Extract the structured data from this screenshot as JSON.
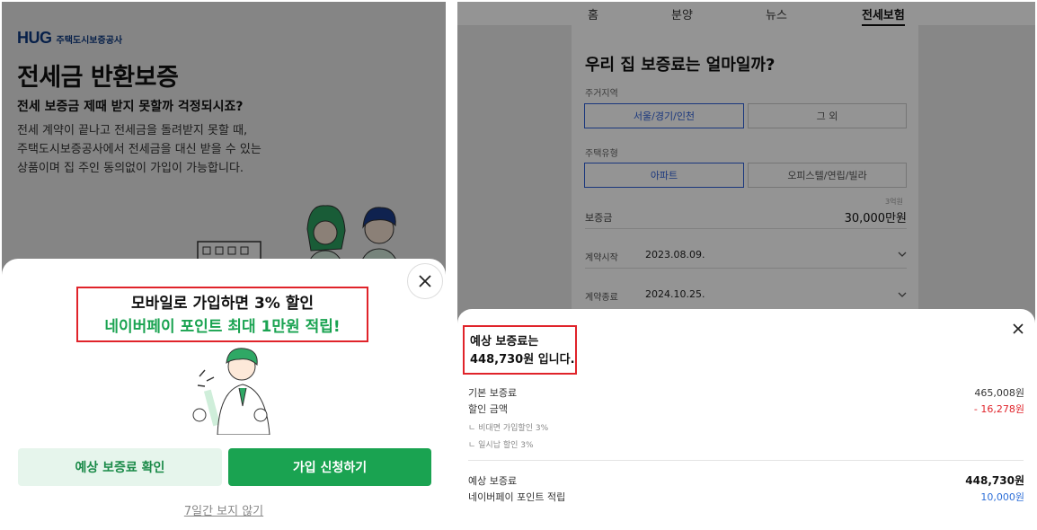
{
  "left": {
    "brand_mark": "HUG",
    "brand_name": "주택도시보증공사",
    "title": "전세금 반환보증",
    "subtitle": "전세 보증금 제때 받지 못할까 걱정되시죠?",
    "description": [
      "전세 계약이 끝나고 전세금을 돌려받지 못할 때,",
      "주택도시보증공사에서 전세금을 대신 받을 수 있는",
      "상품이며 집 주인 동의없이 가입이 가능합니다."
    ],
    "promo": {
      "line1": "모바일로 가입하면 3% 할인",
      "line2": "네이버페이 포인트 최대 1만원 적립!"
    },
    "buttons": {
      "estimate": "예상 보증료 확인",
      "apply": "가입 신청하기"
    },
    "skip_link": "7일간 보지 않기",
    "colors": {
      "brand": "#0d3b86",
      "accent_green": "#1aa351",
      "highlight_red": "#e0232a"
    }
  },
  "right": {
    "tabs": [
      "홈",
      "분양",
      "뉴스",
      "전세보험"
    ],
    "active_tab": "전세보험",
    "question_title": "우리 집 보증료는 얼마일까?",
    "region": {
      "label": "주거지역",
      "options": [
        "서울/경기/인천",
        "그 외"
      ],
      "selected": "서울/경기/인천"
    },
    "house_type": {
      "label": "주택유형",
      "options": [
        "아파트",
        "오피스텔/연립/빌라"
      ],
      "selected": "아파트"
    },
    "deposit": {
      "label": "보증금",
      "hint": "3억원",
      "value": "30,000만원"
    },
    "contract_start": {
      "label": "계약시작",
      "value": "2023.08.09."
    },
    "contract_end": {
      "label": "계약종료",
      "value": "2024.10.25."
    },
    "result": {
      "headline_line1": "예상 보증료는",
      "headline_amount": "448,730원",
      "headline_suffix": " 입니다.",
      "base_fee_label": "기본 보증료",
      "base_fee_value": "465,008원",
      "discount_label": "할인 금액",
      "discount_value": "- 16,278원",
      "discount_items": [
        "비대면 가입할인 3%",
        "일시납 할인 3%"
      ],
      "estimated_label": "예상 보증료",
      "estimated_value": "448,730원",
      "points_label": "네이버페이 포인트 적립",
      "points_value": "10,000원"
    },
    "colors": {
      "selected_blue": "#2e5fd8",
      "discount_red": "#e0232a",
      "points_blue": "#2e6fd8"
    }
  }
}
